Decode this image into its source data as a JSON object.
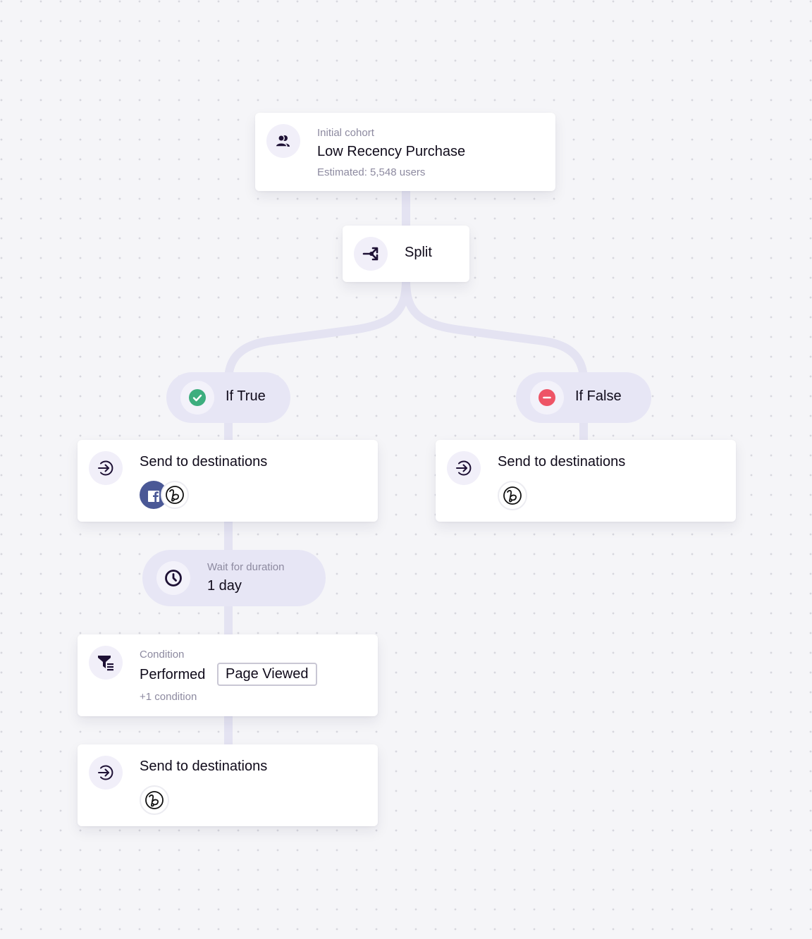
{
  "colors": {
    "background": "#f5f5f8",
    "connector": "#e4e3f2",
    "icon_dark": "#1e1135",
    "success": "#3dae7e",
    "danger": "#ee5466",
    "facebook": "#4a5896"
  },
  "initial_cohort": {
    "icon": "users-icon",
    "label": "Initial cohort",
    "title": "Low Recency Purchase",
    "estimate": "Estimated: 5,548 users"
  },
  "split": {
    "icon": "split-icon",
    "label": "Split"
  },
  "branches": {
    "true": {
      "icon": "check-circle-icon",
      "label": "If True"
    },
    "false": {
      "icon": "minus-circle-icon",
      "label": "If False"
    }
  },
  "true_path": {
    "send_1": {
      "icon": "arrow-right-enter-icon",
      "title": "Send to destinations",
      "destinations": [
        "facebook-logo",
        "braze-logo"
      ]
    },
    "wait": {
      "icon": "clock-icon",
      "label": "Wait for duration",
      "value": "1 day"
    },
    "condition": {
      "icon": "filter-list-icon",
      "label": "Condition",
      "verb": "Performed",
      "event": "Page Viewed",
      "extra": "+1 condition"
    },
    "send_2": {
      "icon": "arrow-right-enter-icon",
      "title": "Send to destinations",
      "destinations": [
        "braze-logo"
      ]
    }
  },
  "false_path": {
    "send_1": {
      "icon": "arrow-right-enter-icon",
      "title": "Send to destinations",
      "destinations": [
        "braze-logo"
      ]
    }
  }
}
